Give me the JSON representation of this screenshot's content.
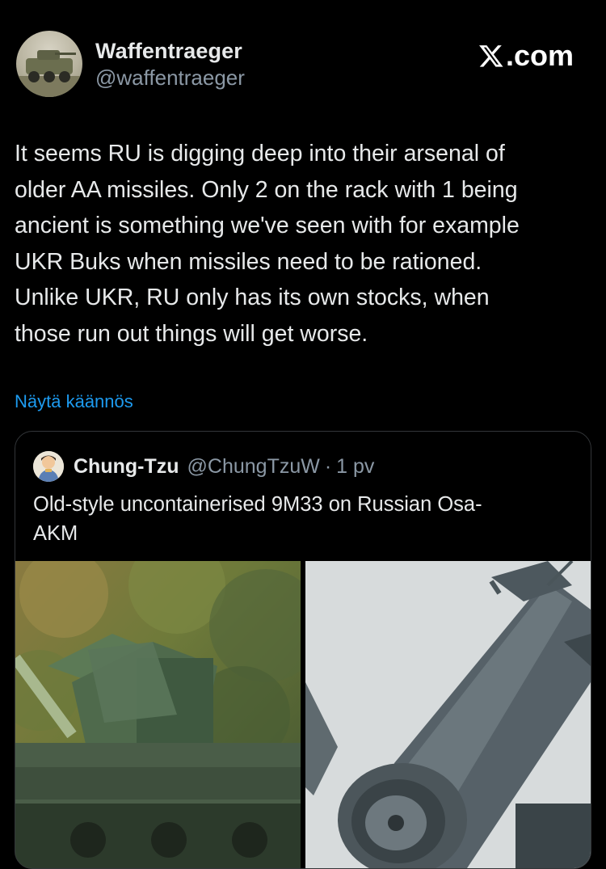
{
  "author": {
    "display_name": "Waffentraeger",
    "handle": "@waffentraeger"
  },
  "brand": {
    "label": ".com",
    "logo_icon": "x-logo-icon"
  },
  "tweet": {
    "text": "It seems RU is digging deep into their arsenal of\nolder AA missiles. Only 2 on the rack with 1 being\nancient is something we've seen with for example\nUKR Buks when missiles need to be rationed.\nUnlike UKR, RU only has its own stocks, when\nthose run out things will get worse.",
    "translate_label": "Näytä käännös"
  },
  "quote": {
    "display_name": "Chung-Tzu",
    "handle": "@ChungTzuW",
    "separator": "·",
    "time": "1 pv",
    "text": "Old-style uncontainerised 9M33 on Russian Osa-\nAKM",
    "images": [
      "osa-akm-vehicle-photo",
      "9m33-missile-closeup-photo"
    ]
  },
  "colors": {
    "background": "#000000",
    "text": "#e7e9ea",
    "secondary": "#8b98a5",
    "link": "#1d9bf0",
    "border": "#333639"
  }
}
